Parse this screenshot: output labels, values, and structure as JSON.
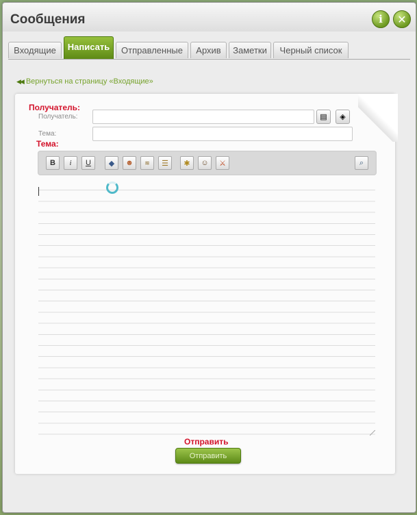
{
  "window": {
    "title": "Сообщения"
  },
  "tabs": [
    {
      "label": "Входящие"
    },
    {
      "label": "Написать"
    },
    {
      "label": "Отправленные"
    },
    {
      "label": "Архив"
    },
    {
      "label": "Заметки"
    },
    {
      "label": "Черный список"
    }
  ],
  "back_link": "Вернуться на страницу «Входящие»",
  "form": {
    "recipient_label_red": "Получатель:",
    "recipient_label": "Получатель:",
    "recipient_value": "",
    "subject_label": "Тема:",
    "subject_label_red": "Тема:",
    "subject_value": ""
  },
  "toolbar": {
    "bold": "B",
    "italic": "i",
    "underline": "U"
  },
  "send": {
    "label_red": "Отправить",
    "button": "Отправить"
  },
  "colors": {
    "accent_green": "#6e9a22",
    "annotation_red": "#d3132b"
  }
}
